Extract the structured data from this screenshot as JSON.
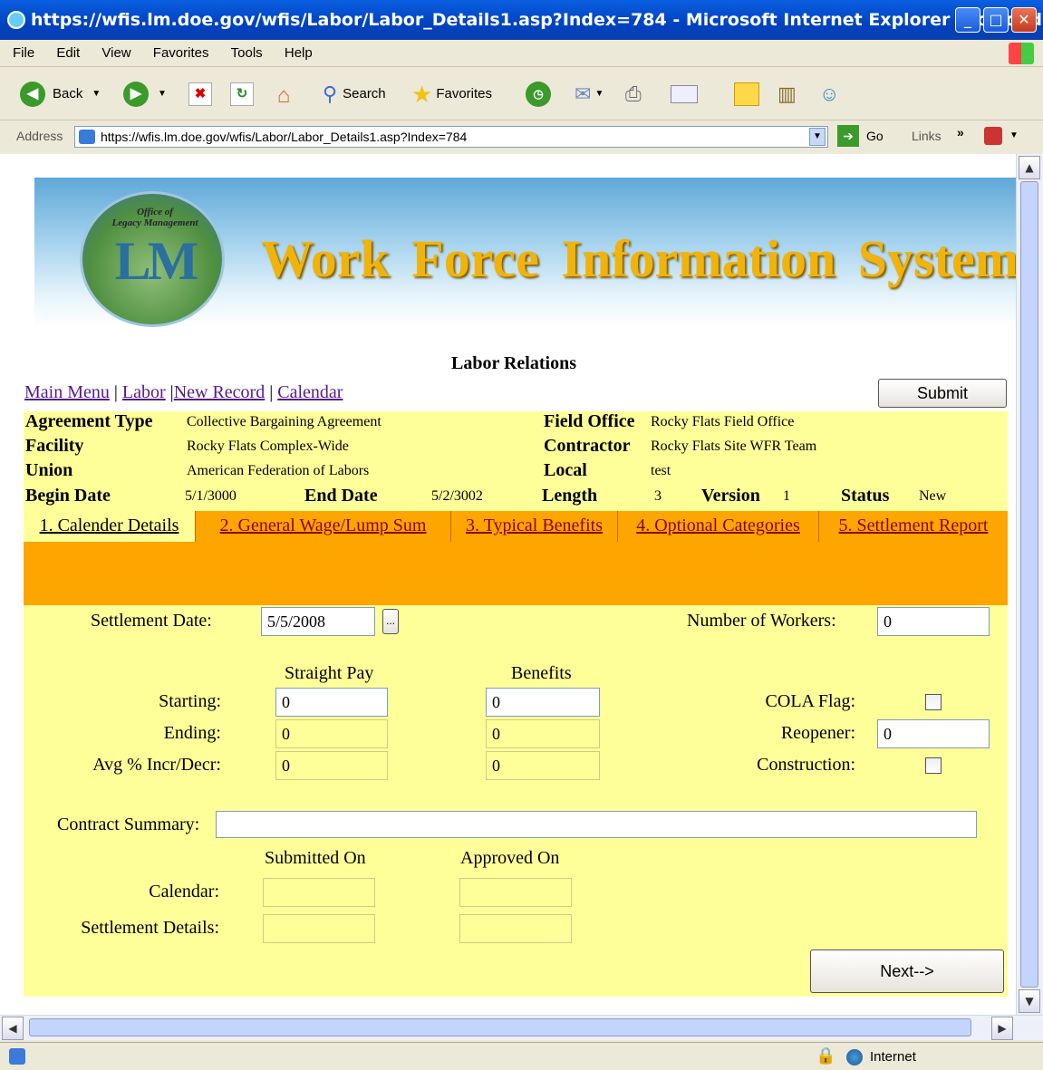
{
  "window": {
    "title": "https://wfis.lm.doe.gov/wfis/Labor/Labor_Details1.asp?Index=784 - Microsoft Internet Explorer provided by ...",
    "minimize": "_",
    "maximize": "□",
    "close": "✕"
  },
  "menu": [
    "File",
    "Edit",
    "View",
    "Favorites",
    "Tools",
    "Help"
  ],
  "toolbar": {
    "back": "Back",
    "search": "Search",
    "favorites": "Favorites"
  },
  "address": {
    "label": "Address",
    "url": "https://wfis.lm.doe.gov/wfis/Labor/Labor_Details1.asp?Index=784",
    "go": "Go",
    "links": "Links"
  },
  "banner": {
    "logo_text": "Office of\nLegacy Management",
    "logo_letters": "LM",
    "title": "Work Force Information  System"
  },
  "page": {
    "title": "Labor Relations",
    "nav": [
      "Main Menu",
      "Labor",
      "New Record",
      "Calendar"
    ],
    "submit": "Submit"
  },
  "info": {
    "agreement_type_label": "Agreement Type",
    "agreement_type": "Collective Bargaining Agreement",
    "facility_label": "Facility",
    "facility": "Rocky Flats Complex-Wide",
    "union_label": "Union",
    "union": "American Federation of Labors",
    "begin_date_label": "Begin Date",
    "begin_date": "5/1/3000",
    "end_date_label": "End Date",
    "end_date": "5/2/3002",
    "field_office_label": "Field Office",
    "field_office": "Rocky Flats Field Office",
    "contractor_label": "Contractor",
    "contractor": "Rocky Flats Site WFR Team",
    "local_label": "Local",
    "local": "test",
    "length_label": "Length",
    "length": "3",
    "version_label": "Version",
    "version": "1",
    "status_label": "Status",
    "status": "New"
  },
  "tabs": [
    "1. Calender Details",
    "2. General Wage/Lump Sum",
    "3. Typical Benefits",
    "4. Optional Categories",
    "5. Settlement Report"
  ],
  "form": {
    "settlement_date_label": "Settlement Date:",
    "settlement_date": "5/5/2008",
    "date_picker": "...",
    "num_workers_label": "Number of Workers:",
    "num_workers": "0",
    "straight_pay_header": "Straight Pay",
    "benefits_header": "Benefits",
    "starting_label": "Starting:",
    "ending_label": "Ending:",
    "avg_label": "Avg % Incr/Decr:",
    "starting_pay": "0",
    "ending_pay": "0",
    "avg_pay": "0",
    "starting_benefits": "0",
    "ending_benefits": "0",
    "avg_benefits": "0",
    "cola_label": "COLA Flag:",
    "reopener_label": "Reopener:",
    "reopener": "0",
    "construction_label": "Construction:",
    "contract_summary_label": "Contract Summary:",
    "contract_summary": "",
    "submitted_on_header": "Submitted On",
    "approved_on_header": "Approved On",
    "calendar_label": "Calendar:",
    "settlement_details_label": "Settlement Details:",
    "next_button": "Next-->"
  },
  "status": {
    "zone": "Internet"
  }
}
